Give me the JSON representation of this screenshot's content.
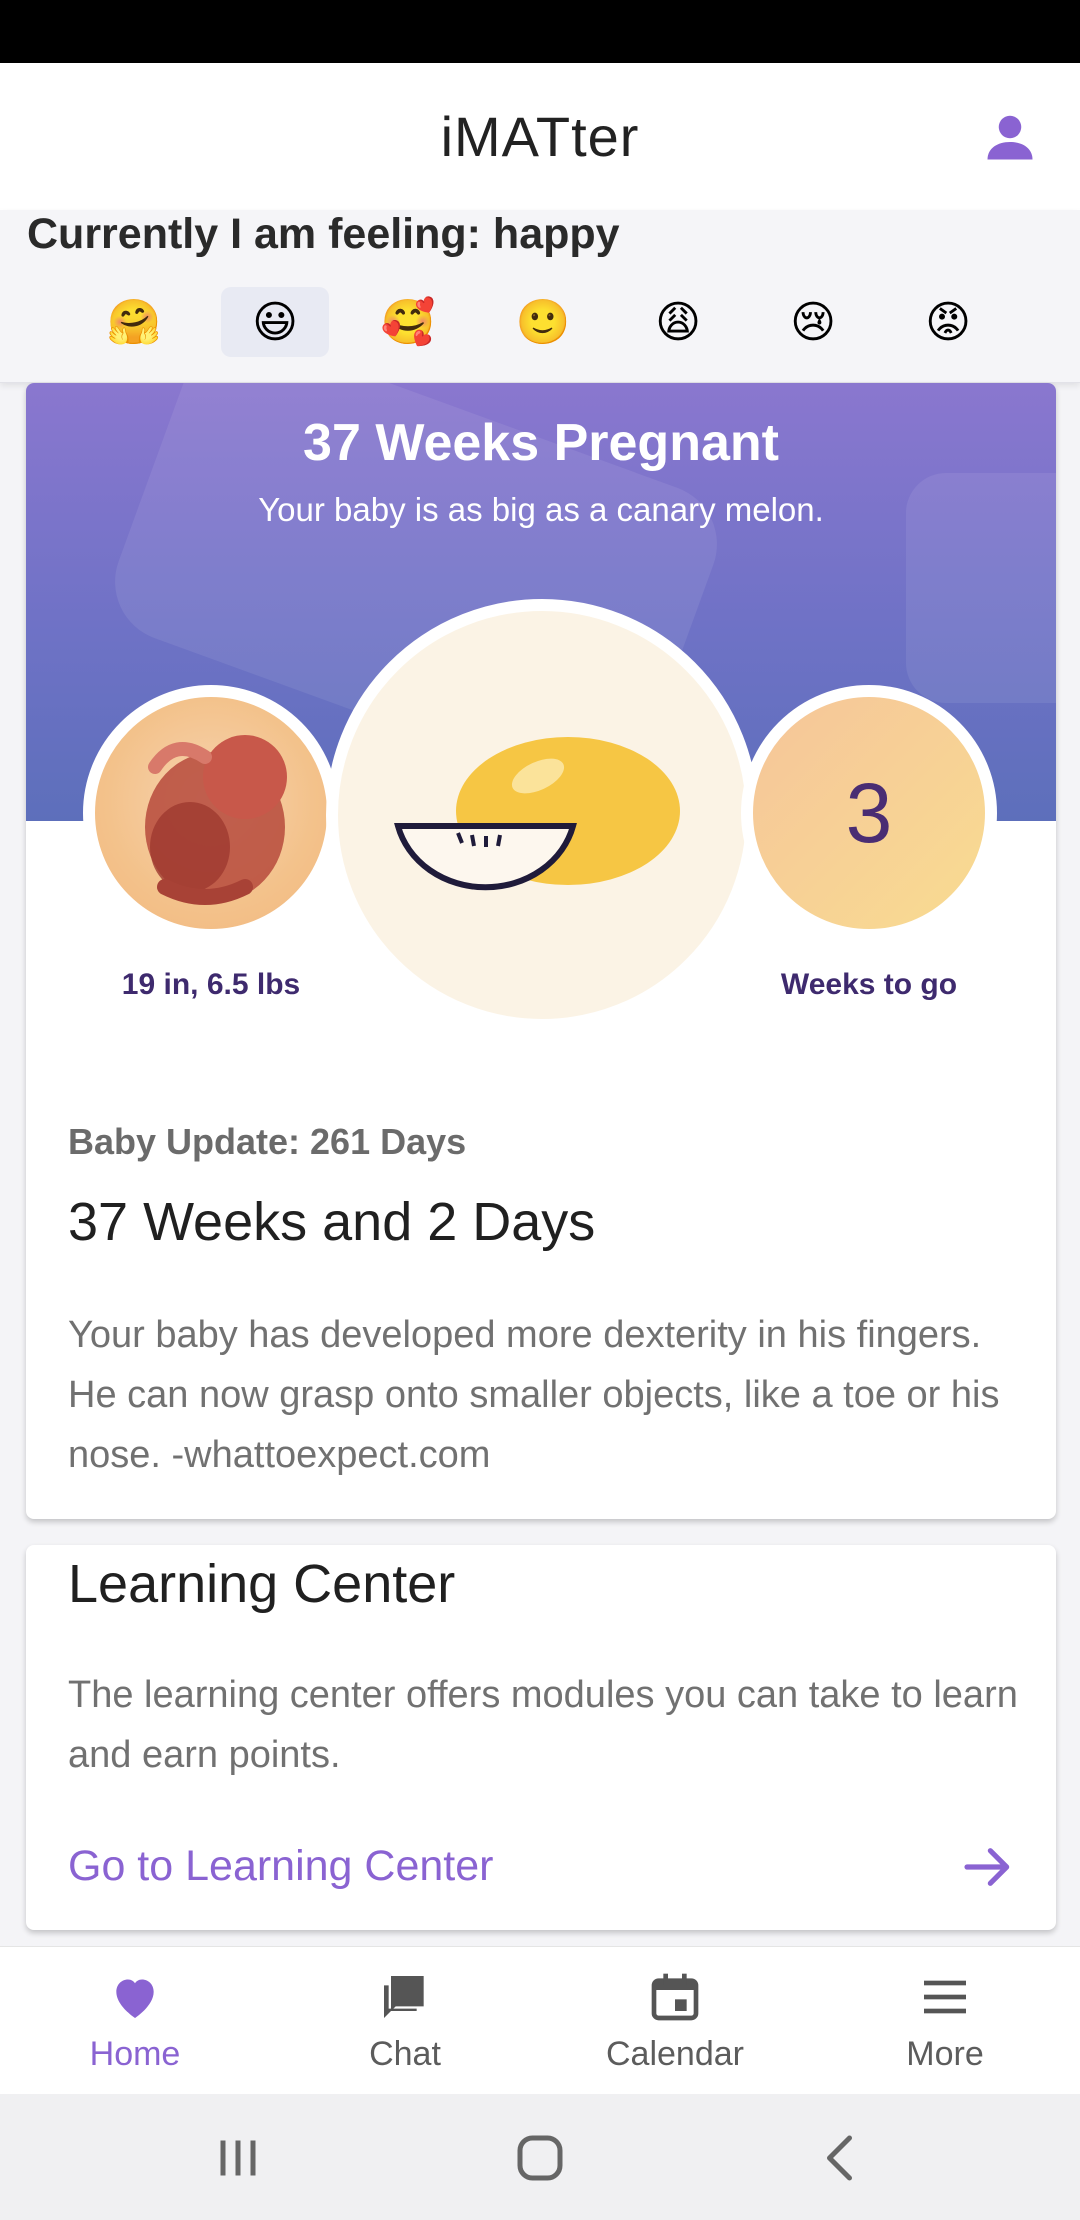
{
  "app": {
    "title": "iMATter"
  },
  "mood": {
    "label": "Currently I am feeling: happy",
    "options": [
      {
        "emoji": "🤗",
        "name": "hug"
      },
      {
        "emoji": "😃",
        "name": "happy",
        "selected": true
      },
      {
        "emoji": "🥰",
        "name": "loved"
      },
      {
        "emoji": "🙂",
        "name": "neutral"
      },
      {
        "emoji": "😩",
        "name": "weary"
      },
      {
        "emoji": "😢",
        "name": "sad"
      },
      {
        "emoji": "😡",
        "name": "angry"
      }
    ]
  },
  "pregnancy": {
    "title": "37 Weeks Pregnant",
    "subtitle": "Your baby is as big as a canary melon.",
    "size": "19 in, 6.5 lbs",
    "weeks_to_go_value": "3",
    "weeks_to_go_label": "Weeks to go",
    "update_subtitle": "Baby Update: 261 Days",
    "update_title": "37 Weeks and 2 Days",
    "update_body": "Your baby has developed more dexterity in his fingers. He can now grasp onto smaller objects, like a toe or his nose. -whattoexpect.com"
  },
  "learning": {
    "title": "Learning Center",
    "body": "The learning center offers modules you can take to learn and earn points.",
    "link": "Go to Learning Center"
  },
  "nav": {
    "items": [
      {
        "label": "Home",
        "icon": "heart-icon",
        "active": true
      },
      {
        "label": "Chat",
        "icon": "chat-icon"
      },
      {
        "label": "Calendar",
        "icon": "calendar-icon"
      },
      {
        "label": "More",
        "icon": "menu-icon"
      }
    ]
  },
  "colors": {
    "accent": "#8a63d2",
    "hero": "#7b74cb"
  }
}
